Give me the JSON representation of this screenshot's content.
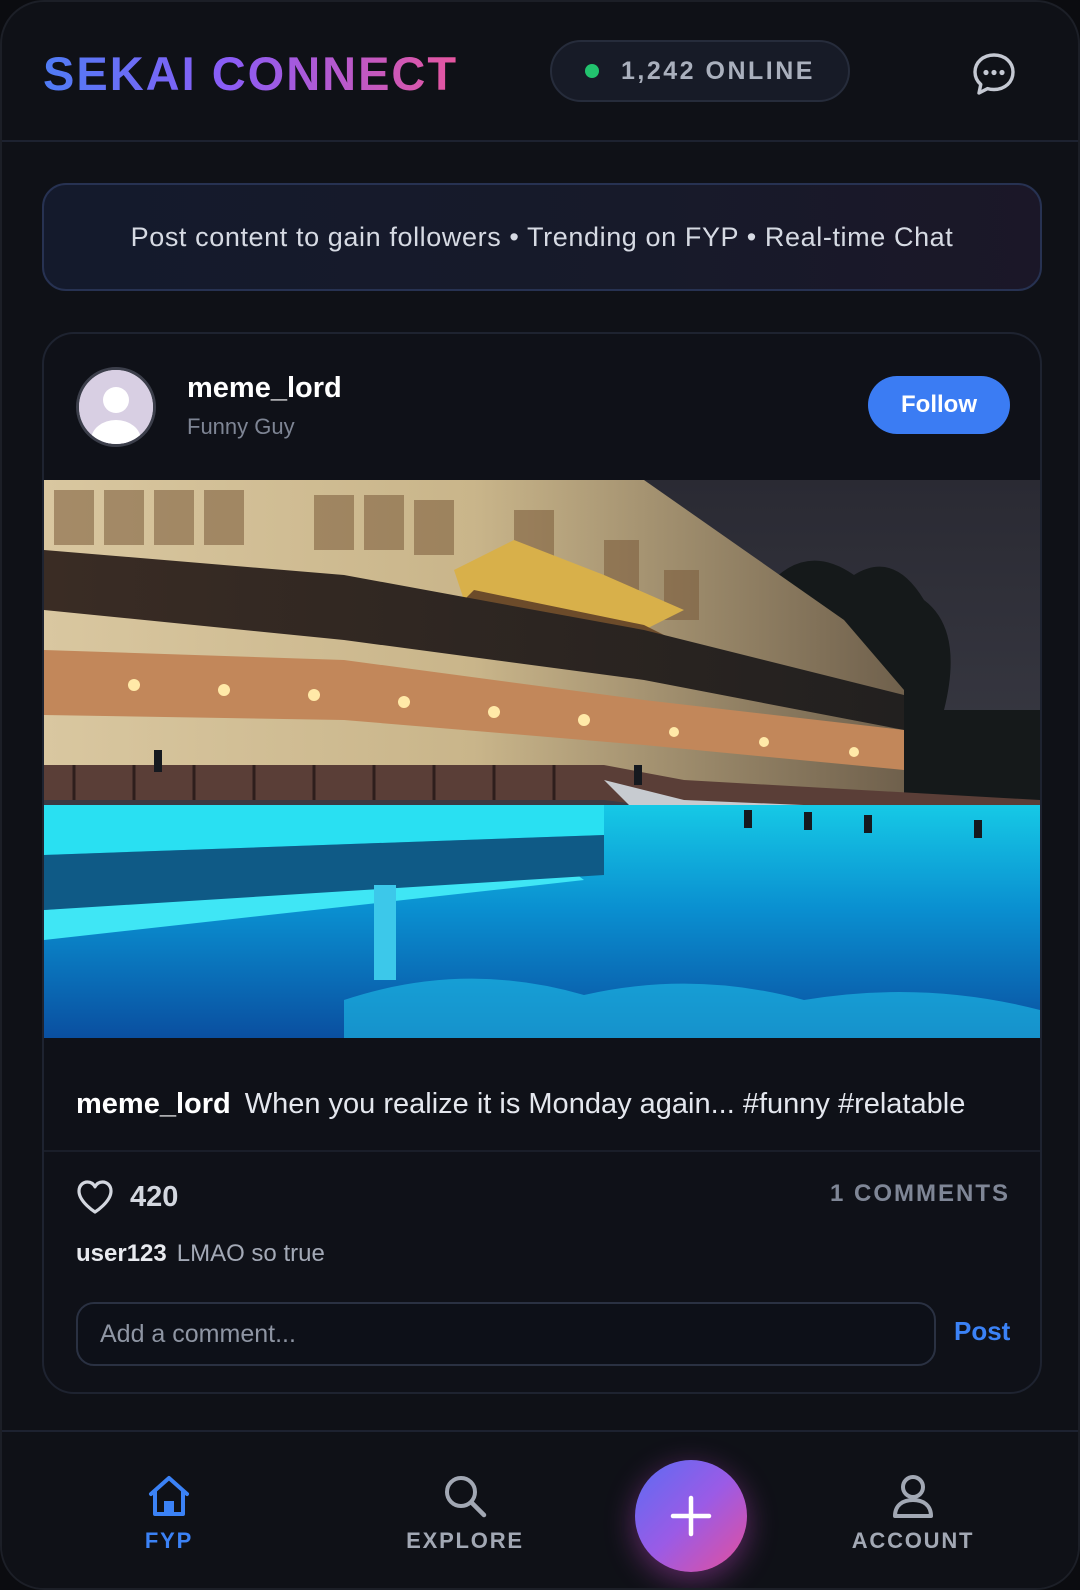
{
  "header": {
    "brand": "SEKAI CONNECT",
    "online_count": "1,242 ONLINE",
    "chat_icon": "chat-bubble-icon"
  },
  "banner": {
    "text": "Post content to gain followers • Trending on FYP • Real-time Chat"
  },
  "post": {
    "username": "meme_lord",
    "user_subtitle": "Funny Guy",
    "follow_label": "Follow",
    "caption_user": "meme_lord",
    "caption_text": "When you realize it is Monday again... #funny #relatable",
    "likes": "420",
    "comments_label": "1 COMMENTS",
    "comments": [
      {
        "user": "user123",
        "text": "LMAO so true"
      }
    ],
    "comment_placeholder": "Add a comment...",
    "post_label": "Post"
  },
  "nav": {
    "items": [
      {
        "label": "FYP",
        "icon": "home-icon",
        "active": true
      },
      {
        "label": "EXPLORE",
        "icon": "search-icon",
        "active": false
      },
      {
        "label": "ACCOUNT",
        "icon": "user-icon",
        "active": false
      }
    ],
    "create_icon": "plus-icon"
  },
  "colors": {
    "accent_blue": "#3b82f6",
    "online_green": "#22c36e",
    "brand_gradient": [
      "#4f7cf5",
      "#8b5cf6",
      "#e6569f"
    ],
    "background": "#0f1117"
  }
}
